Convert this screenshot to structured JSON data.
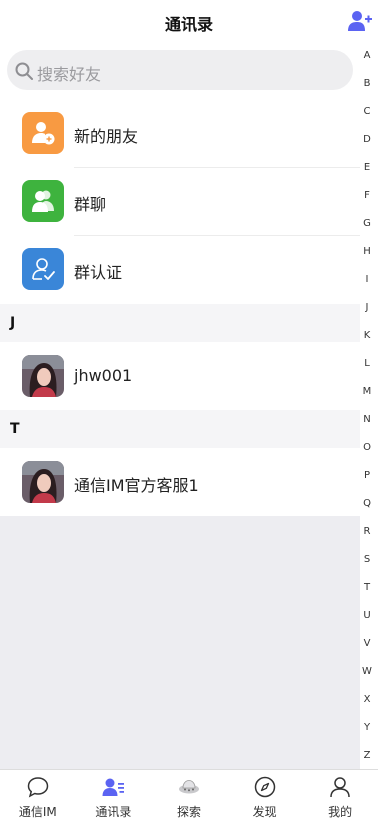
{
  "header": {
    "title": "通讯录"
  },
  "search": {
    "placeholder": "搜索好友"
  },
  "functions": [
    {
      "label": "新的朋友",
      "icon": "new-friend-icon",
      "color": "#f89a42"
    },
    {
      "label": "群聊",
      "icon": "group-chat-icon",
      "color": "#3eb33e"
    },
    {
      "label": "群认证",
      "icon": "group-verify-icon",
      "color": "#3a86d8"
    }
  ],
  "sections": [
    {
      "letter": "J",
      "contacts": [
        {
          "name": "jhw001"
        }
      ]
    },
    {
      "letter": "T",
      "contacts": [
        {
          "name": "通信IM官方客服1"
        }
      ]
    }
  ],
  "index_letters": [
    "A",
    "B",
    "C",
    "D",
    "E",
    "F",
    "G",
    "H",
    "I",
    "J",
    "K",
    "L",
    "M",
    "N",
    "O",
    "P",
    "Q",
    "R",
    "S",
    "T",
    "U",
    "V",
    "W",
    "X",
    "Y",
    "Z"
  ],
  "tabs": [
    {
      "label": "通信IM",
      "icon": "chat-bubble-icon",
      "active": false
    },
    {
      "label": "通讯录",
      "icon": "contacts-icon",
      "active": true
    },
    {
      "label": "探索",
      "icon": "ufo-icon",
      "active": false
    },
    {
      "label": "发现",
      "icon": "compass-icon",
      "active": false
    },
    {
      "label": "我的",
      "icon": "profile-icon",
      "active": false
    }
  ],
  "colors": {
    "accent": "#5b63f2",
    "page_bg": "#ededf1"
  }
}
